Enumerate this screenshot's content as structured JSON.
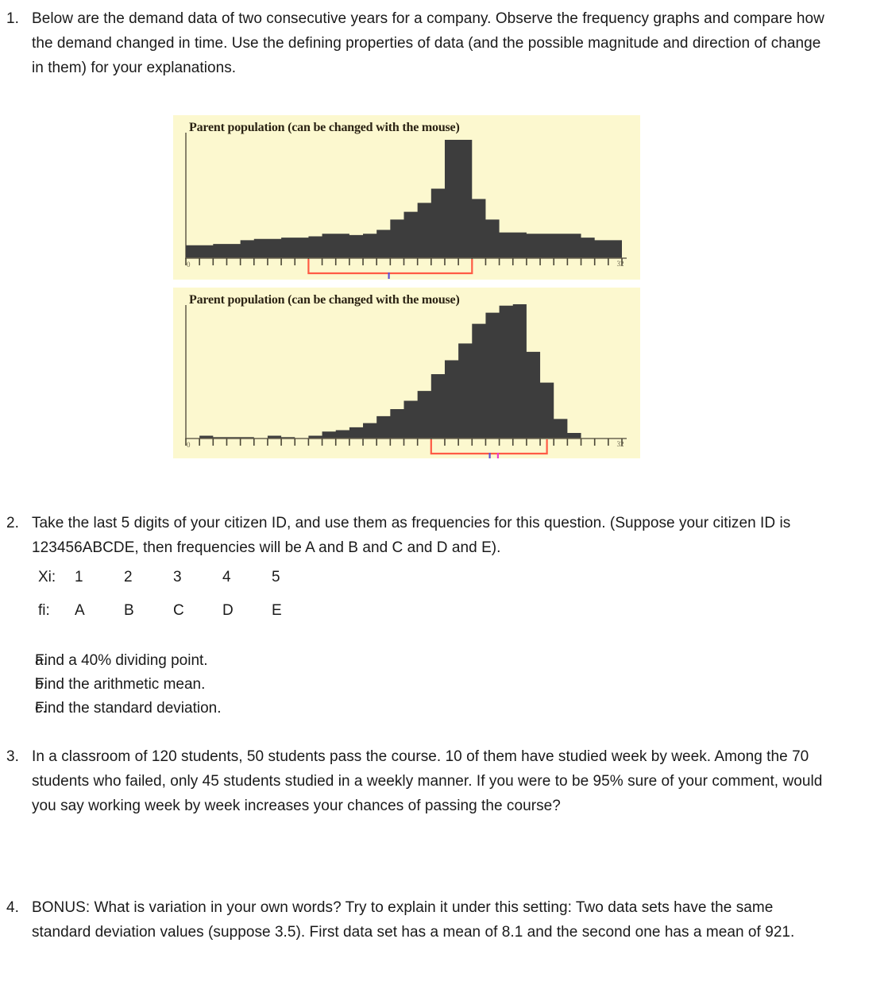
{
  "document": {
    "background": "#ffffff",
    "text_color": "#1a1a1a"
  },
  "questions": [
    {
      "number": "1.",
      "text": "Below are the demand data of two consecutive years for a company. Observe the frequency graphs and compare how the demand changed in time. Use the defining properties of data (and the possible magnitude and direction of change in them) for your explanations."
    },
    {
      "number": "2.",
      "text": "Take the last 5 digits of your citizen ID, and use them as frequencies for this question. (Suppose your citizen ID is 123456ABCDE, then frequencies will be A and B and C and D and E)."
    },
    {
      "number": "3.",
      "text": "In a classroom of 120 students, 50 students pass the course. 10 of them have studied week by week. Among the 70 students who failed, only 45 students studied in a weekly manner. If you were to be 95% sure of your comment, would you say working week by week increases your chances of passing the course?"
    },
    {
      "number": "4.",
      "text": "BONUS: What is variation in your own words? Try to explain it under this setting: Two data sets have the same standard deviation values (suppose 3.5). First data set has a mean of 8.1 and the second one has a mean of 921."
    }
  ],
  "frequency_table": {
    "xi_label": "Xi:",
    "fi_label": "fi:",
    "xi_values": [
      "1",
      "2",
      "3",
      "4",
      "5"
    ],
    "fi_values": [
      "A",
      "B",
      "C",
      "D",
      "E"
    ]
  },
  "subquestions": [
    {
      "marker": "a.",
      "text": "Find a 40% dividing point."
    },
    {
      "marker": "b.",
      "text": "Find the arithmetic mean."
    },
    {
      "marker": "c.",
      "text": "Find the standard deviation."
    }
  ],
  "applets": {
    "background_color": "#fcf8cf",
    "bar_color": "#3d3d3d",
    "axis_color": "#6b6550",
    "bracket_color": "#ff5b45",
    "mean_marker_color": "#5c52d8",
    "median_marker_color": "#e83fd0",
    "axis_start_label": "0",
    "axis_end_label": "32"
  },
  "chart_data": [
    {
      "type": "bar",
      "title": "Parent population (can be changed with the mouse)",
      "xlabel": "",
      "ylabel": "",
      "xlim": [
        0,
        32
      ],
      "ylim": [
        0,
        100
      ],
      "grid": false,
      "legend": "none",
      "categories": [
        "0",
        "1",
        "2",
        "3",
        "4",
        "5",
        "6",
        "7",
        "8",
        "9",
        "10",
        "11",
        "12",
        "13",
        "14",
        "15",
        "16",
        "17",
        "18",
        "19",
        "20",
        "21",
        "22",
        "23",
        "24",
        "25",
        "26",
        "27",
        "28",
        "29",
        "30",
        "31"
      ],
      "values": [
        10,
        10,
        11,
        11,
        14,
        15,
        15,
        16,
        16,
        17,
        19,
        19,
        18,
        19,
        22,
        30,
        36,
        43,
        54,
        92,
        92,
        46,
        30,
        20,
        20,
        19,
        19,
        19,
        19,
        16,
        14,
        14
      ],
      "annotations": {
        "bracket_from_category": 9,
        "bracket_to_category": 21,
        "mean_marker_category": 14.9,
        "median_marker_category": 14.9
      }
    },
    {
      "type": "bar",
      "title": "Parent population (can be changed with the mouse)",
      "xlabel": "",
      "ylabel": "",
      "xlim": [
        0,
        32
      ],
      "ylim": [
        0,
        100
      ],
      "grid": false,
      "legend": "none",
      "categories": [
        "0",
        "1",
        "2",
        "3",
        "4",
        "5",
        "6",
        "7",
        "8",
        "9",
        "10",
        "11",
        "12",
        "13",
        "14",
        "15",
        "16",
        "17",
        "18",
        "19",
        "20",
        "21",
        "22",
        "23",
        "24",
        "25",
        "26",
        "27",
        "28",
        "29",
        "30",
        "31"
      ],
      "values": [
        0,
        2,
        1,
        1,
        1,
        0,
        2,
        1,
        0,
        2,
        5,
        6,
        8,
        11,
        16,
        21,
        27,
        34,
        46,
        56,
        68,
        82,
        90,
        95,
        96,
        62,
        40,
        14,
        4,
        0,
        0,
        0
      ],
      "annotations": {
        "bracket_from_category": 18,
        "bracket_to_category": 26.5,
        "mean_marker_category": 22.3,
        "median_marker_category": 22.9
      }
    }
  ]
}
